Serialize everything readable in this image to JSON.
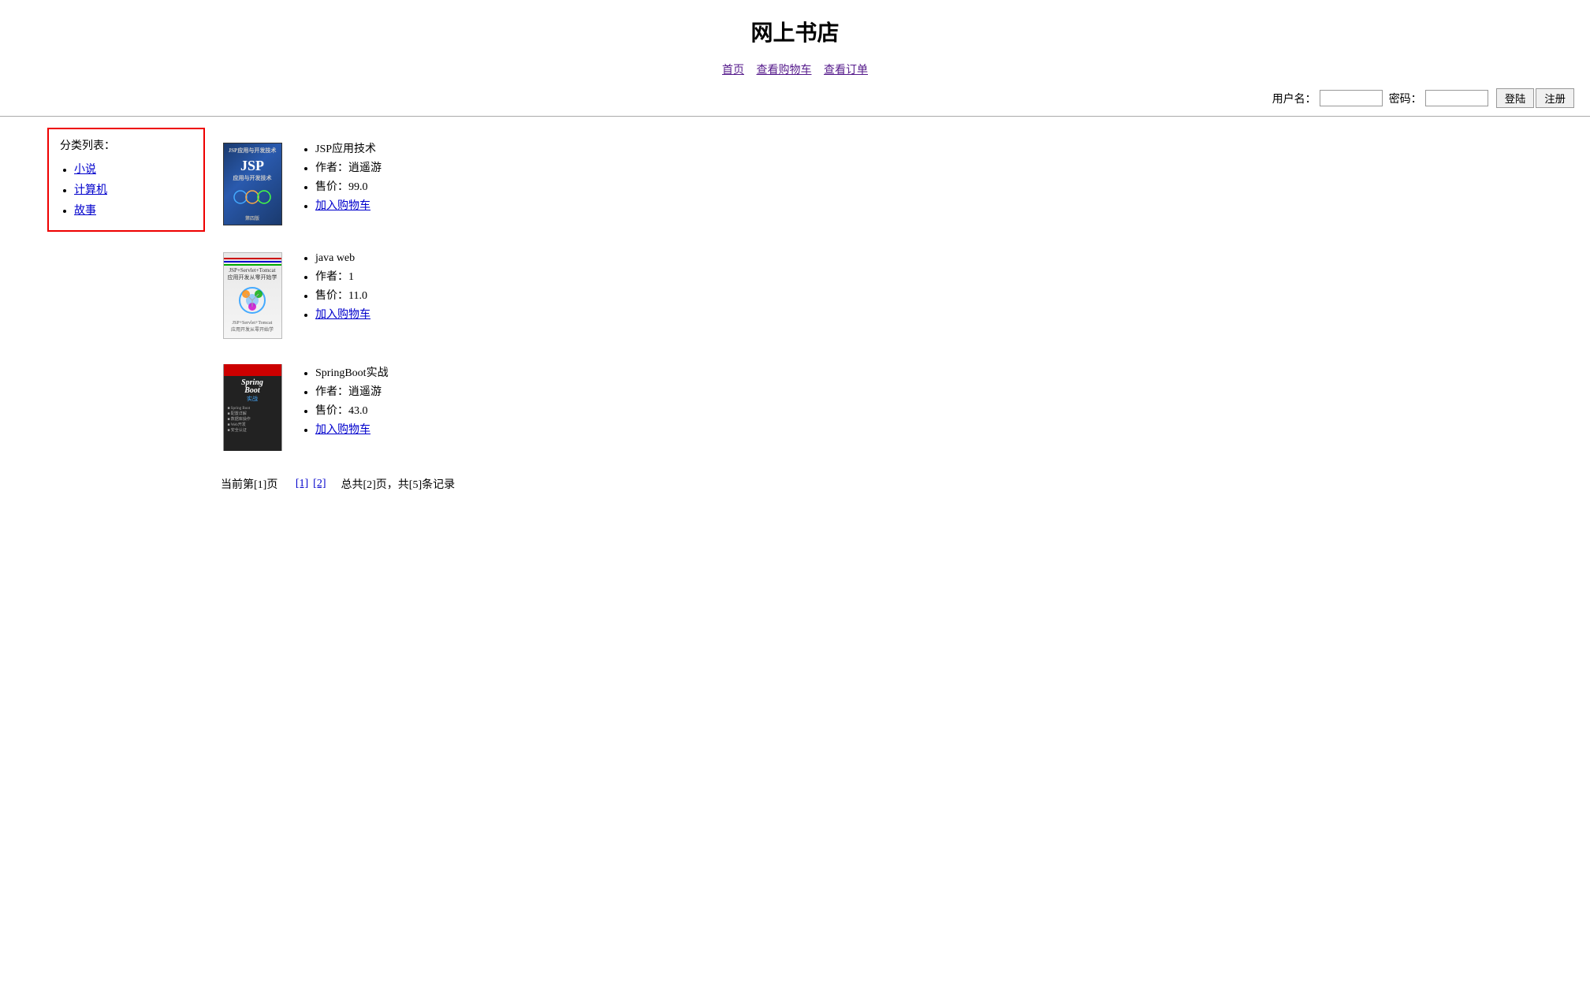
{
  "header": {
    "title": "网上书店"
  },
  "nav": {
    "home": "首页",
    "cart": "查看购物车",
    "orders": "查看订单"
  },
  "login": {
    "username_label": "用户名：",
    "password_label": "密码：",
    "login_btn": "登陆",
    "register_btn": "注册"
  },
  "sidebar": {
    "title": "分类列表：",
    "items": [
      {
        "label": "小说",
        "href": "#"
      },
      {
        "label": "计算机",
        "href": "#"
      },
      {
        "label": "故事",
        "href": "#"
      }
    ]
  },
  "books": [
    {
      "id": 1,
      "cover_type": "jsp",
      "title": "JSP应用技术",
      "author_label": "作者：",
      "author": "逍遥游",
      "price_label": "售价：",
      "price": "99.0",
      "add_to_cart": "加入购物车"
    },
    {
      "id": 2,
      "cover_type": "javaweb",
      "title": "java web",
      "author_label": "作者：",
      "author": "1",
      "price_label": "售价：",
      "price": "11.0",
      "add_to_cart": "加入购物车"
    },
    {
      "id": 3,
      "cover_type": "springboot",
      "title": "SpringBoot实战",
      "author_label": "作者：",
      "author": "逍遥游",
      "price_label": "售价：",
      "price": "43.0",
      "add_to_cart": "加入购物车"
    }
  ],
  "pagination": {
    "current": "当前第[1]页",
    "page1": "[1]",
    "page2": "[2]",
    "total": "总共[2]页，共[5]条记录"
  }
}
